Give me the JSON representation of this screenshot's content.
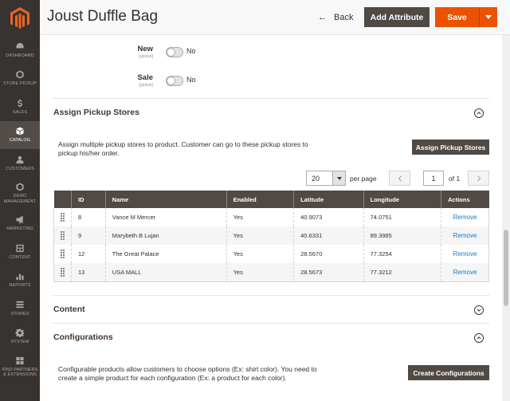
{
  "sidebar": {
    "items": [
      {
        "label": "DASHBOARD",
        "icon": "dashboard-icon"
      },
      {
        "label": "STORE PICKUP",
        "icon": "hexagon-icon"
      },
      {
        "label": "SALES",
        "icon": "dollar-icon"
      },
      {
        "label": "CATALOG",
        "icon": "cube-icon",
        "active": true
      },
      {
        "label": "CUSTOMERS",
        "icon": "customers-icon"
      },
      {
        "label": "DEMO MANAGEMENT",
        "icon": "hexagon-icon"
      },
      {
        "label": "MARKETING",
        "icon": "megaphone-icon"
      },
      {
        "label": "CONTENT",
        "icon": "content-icon"
      },
      {
        "label": "REPORTS",
        "icon": "bar-chart-icon"
      },
      {
        "label": "STORES",
        "icon": "stores-icon"
      },
      {
        "label": "SYSTEM",
        "icon": "gear-icon"
      },
      {
        "label": "FIND PARTNERS & EXTENSIONS",
        "icon": "extensions-icon"
      }
    ]
  },
  "header": {
    "title": "Joust Duffle Bag",
    "back_label": "Back",
    "add_attribute_label": "Add Attribute",
    "save_label": "Save"
  },
  "fields": {
    "new": {
      "label": "New",
      "scope": "[global]",
      "value": "No"
    },
    "sale": {
      "label": "Sale",
      "scope": "[global]",
      "value": "No"
    }
  },
  "pickup": {
    "title": "Assign Pickup Stores",
    "description": "Assign multiple pickup stores to product. Customer can go to these pickup stores to pickup his/her order.",
    "button_label": "Assign Pickup Stores",
    "per_page_value": "20",
    "per_page_label": "per page",
    "page_value": "1",
    "page_of": "of 1",
    "columns": [
      "ID",
      "Name",
      "Enabled",
      "Latitude",
      "Longitude",
      "Actions"
    ],
    "rows": [
      {
        "id": "8",
        "name": "Vance M Mercer",
        "enabled": "Yes",
        "lat": "40.9073",
        "lng": "74.0751",
        "action": "Remove"
      },
      {
        "id": "9",
        "name": "Marybeth B Lujan",
        "enabled": "Yes",
        "lat": "40.6331",
        "lng": "89.3985",
        "action": "Remove"
      },
      {
        "id": "12",
        "name": "The Great Palace",
        "enabled": "Yes",
        "lat": "28.5670",
        "lng": "77.3254",
        "action": "Remove"
      },
      {
        "id": "13",
        "name": "USA MALL",
        "enabled": "Yes",
        "lat": "28.5673",
        "lng": "77.3212",
        "action": "Remove"
      }
    ]
  },
  "content": {
    "title": "Content"
  },
  "configurations": {
    "title": "Configurations",
    "description": "Configurable products allow customers to choose options (Ex: shirt color). You need to create a simple product for each configuration (Ex: a product for each color).",
    "button_label": "Create Configurations"
  },
  "colors": {
    "sidebar": "#373330",
    "accent": "#eb5202",
    "dark_button": "#514943",
    "link": "#1979c3"
  }
}
